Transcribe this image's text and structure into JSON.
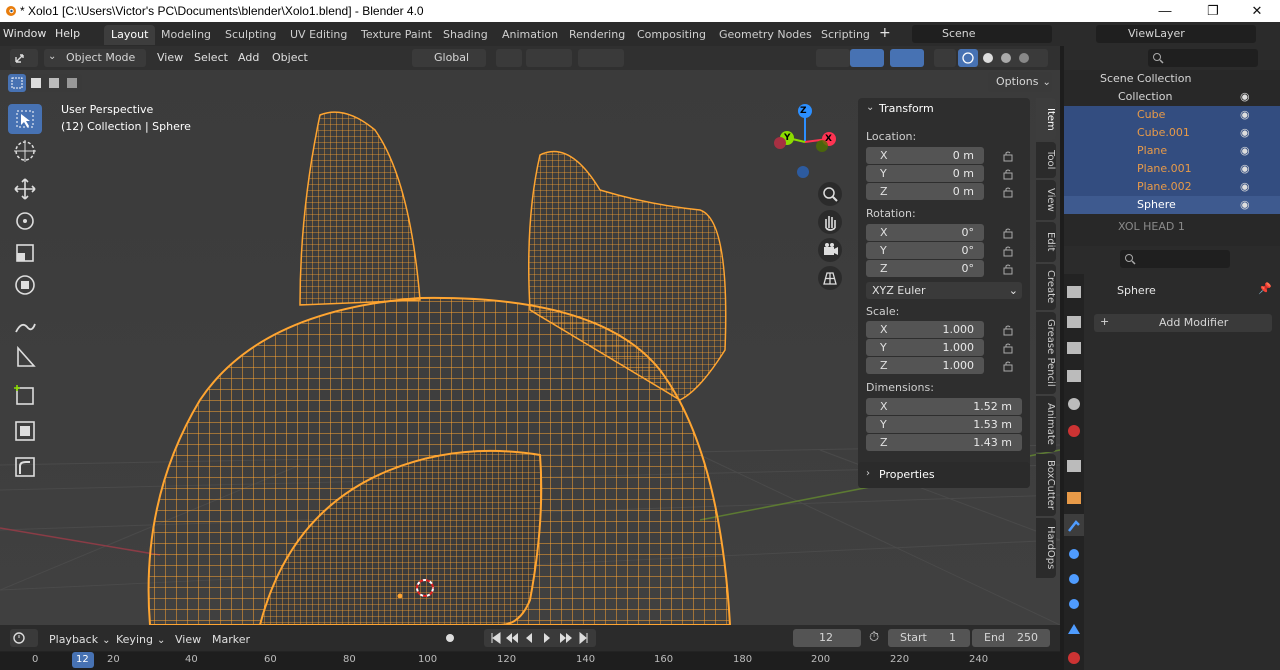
{
  "window": {
    "title": "* Xolo1 [C:\\Users\\Victor's PC\\Documents\\blender\\Xolo1.blend] - Blender 4.0",
    "min_glyph": "—",
    "max_glyph": "❐",
    "close_glyph": "✕"
  },
  "menu": {
    "items": [
      "Window",
      "Help"
    ],
    "workspaces": [
      "Layout",
      "Modeling",
      "Sculpting",
      "UV Editing",
      "Texture Paint",
      "Shading",
      "Animation",
      "Rendering",
      "Compositing",
      "Geometry Nodes",
      "Scripting"
    ],
    "add_glyph": "+",
    "scene": "Scene",
    "view_layer": "ViewLayer"
  },
  "viewport_header": {
    "mode": "Object Mode",
    "menus": [
      "View",
      "Select",
      "Add",
      "Object"
    ],
    "orientation": "Global",
    "options": "Options"
  },
  "viewport": {
    "perspective": "User Perspective",
    "collection_info": "(12) Collection | Sphere",
    "gizmo": {
      "x": "X",
      "y": "Y",
      "z": "Z"
    }
  },
  "npanel": {
    "transform_title": "Transform",
    "location_label": "Location:",
    "location": [
      {
        "axis": "X",
        "value": "0 m"
      },
      {
        "axis": "Y",
        "value": "0 m"
      },
      {
        "axis": "Z",
        "value": "0 m"
      }
    ],
    "rotation_label": "Rotation:",
    "rotation": [
      {
        "axis": "X",
        "value": "0°"
      },
      {
        "axis": "Y",
        "value": "0°"
      },
      {
        "axis": "Z",
        "value": "0°"
      }
    ],
    "rotation_mode": "XYZ Euler",
    "scale_label": "Scale:",
    "scale": [
      {
        "axis": "X",
        "value": "1.000"
      },
      {
        "axis": "Y",
        "value": "1.000"
      },
      {
        "axis": "Z",
        "value": "1.000"
      }
    ],
    "dimensions_label": "Dimensions:",
    "dimensions": [
      {
        "axis": "X",
        "value": "1.52 m"
      },
      {
        "axis": "Y",
        "value": "1.53 m"
      },
      {
        "axis": "Z",
        "value": "1.43 m"
      }
    ],
    "properties_title": "Properties",
    "tabs": [
      "Item",
      "Tool",
      "View",
      "Edit",
      "Create",
      "Grease Pencil",
      "Animate",
      "BoxCutter",
      "HardOps"
    ]
  },
  "outliner": {
    "scene_collection": "Scene Collection",
    "collection": "Collection",
    "objects": [
      "Cube",
      "Cube.001",
      "Plane",
      "Plane.001",
      "Plane.002",
      "Sphere"
    ],
    "other_collection": "XOL HEAD 1"
  },
  "properties": {
    "object_name": "Sphere",
    "add_modifier": "Add Modifier",
    "add_glyph": "+"
  },
  "timeline": {
    "menus": [
      "Playback",
      "Keying",
      "View",
      "Marker"
    ],
    "current_frame": "12",
    "start_label": "Start",
    "start": "1",
    "end_label": "End",
    "end": "250",
    "ruler": [
      "0",
      "12",
      "20",
      "40",
      "60",
      "80",
      "100",
      "120",
      "140",
      "160",
      "180",
      "200",
      "220",
      "240"
    ]
  },
  "colors": {
    "accent": "#4772b3",
    "wire": "#ffa531",
    "object_orange": "#e89a48"
  }
}
